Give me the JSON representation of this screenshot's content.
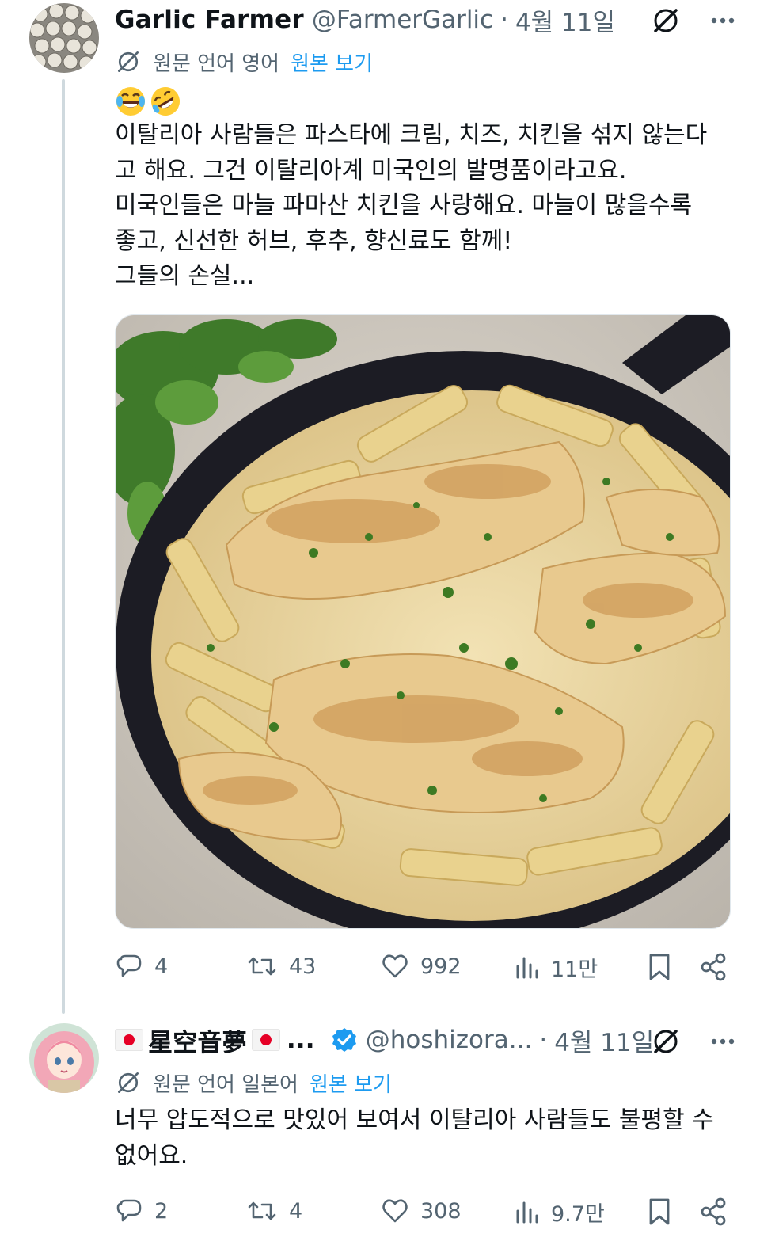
{
  "post1": {
    "display_name": "Garlic Farmer",
    "handle": "@FarmerGarlic",
    "separator": "·",
    "date": "4월 11일",
    "translation_note": "원문 언어 영어",
    "show_original": "원본 보기",
    "emoji_icons": [
      "face-with-tears-of-joy",
      "rolling-on-the-floor-laughing"
    ],
    "lines": [
      "이탈리아 사람들은 파스타에 크림, 치즈, 치킨을 섞지 않는다",
      "고 해요. 그건 이탈리아계 미국인의 발명품이라고요.",
      "미국인들은 마늘 파마산 치킨을 사랑해요. 마늘이 많을수록",
      "좋고, 신선한 허브, 후추, 향신료도 함께!",
      "그들의 손실..."
    ],
    "stats": {
      "replies": "4",
      "reposts": "43",
      "likes": "992",
      "views": "11만"
    }
  },
  "post2": {
    "display_name": "星空音夢",
    "ellipsis": "...",
    "handle": "@hoshizora...",
    "separator": "·",
    "date": "4월 11일",
    "translation_note": "원문 언어 일본어",
    "show_original": "원본 보기",
    "lines": [
      "너무 압도적으로 맛있어 보여서 이탈리아 사람들도 불평할 수",
      "없어요."
    ],
    "stats": {
      "replies": "2",
      "reposts": "4",
      "likes": "308",
      "views": "9.7만"
    }
  },
  "colors": {
    "text": "#0f1419",
    "secondary": "#536471",
    "link": "#1d9bf0",
    "verified": "#1d9bf0",
    "thread_line": "#cfd9de"
  }
}
